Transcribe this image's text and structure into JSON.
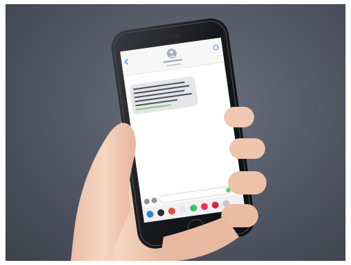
{
  "photo": {
    "description_kind": "stock photo of a hand holding a smartphone showing a messaging app",
    "colors": {
      "background": "#565b68",
      "phone_body": "#1d1e22",
      "screen": "#ffffff",
      "bubble": "#e5e5ea",
      "link": "#8cc98c",
      "skin": "#f2cdb8"
    }
  },
  "screen": {
    "contact_name": "",
    "message_lines": [
      "",
      "",
      "",
      "",
      ""
    ],
    "input_placeholder": ""
  },
  "icons": [
    "back-chevron-icon",
    "contact-avatar-icon",
    "info-icon",
    "camera-icon",
    "app-store-icon",
    "send-button-icon"
  ]
}
